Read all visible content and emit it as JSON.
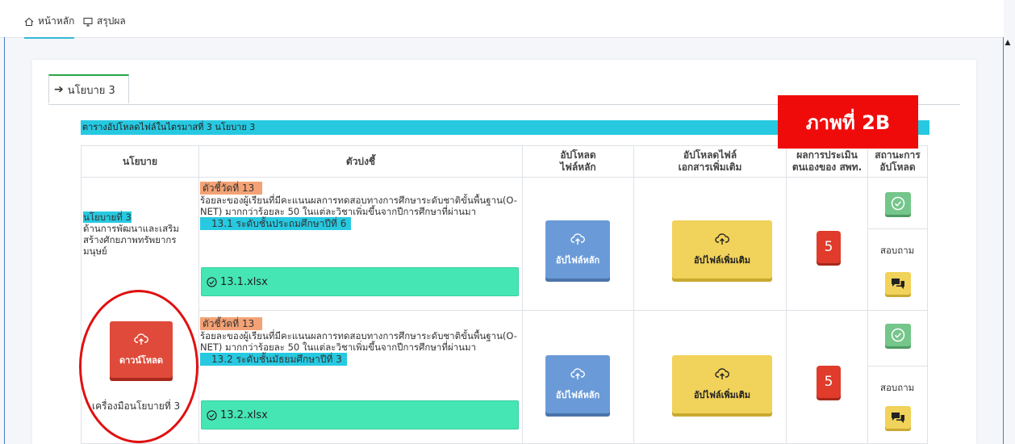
{
  "topnav": {
    "home_label": "หน้าหลัก",
    "summary_label": "สรุปผล"
  },
  "policy_tab": {
    "label": "นโยบาย 3"
  },
  "table": {
    "caption": "ตารางอัปโหลดไฟล์ในไตรมาสที่ 3 นโยบาย 3",
    "headers": {
      "policy": "นโยบาย",
      "indicator": "ตัวบ่งชี้",
      "main_upload_1": "อัปโหลด",
      "main_upload_2": "ไฟล์หลัก",
      "extra_upload_1": "อัปโหลดไฟล์",
      "extra_upload_2": "เอกสารเพิ่มเติม",
      "self_eval_1": "ผลการประเมิน",
      "self_eval_2": "ตนเองของ สพท.",
      "status_1": "สถานะการ",
      "status_2": "อัปโหลด"
    },
    "policy_cell": {
      "title": "นโยบายที่ 3",
      "description": "ด้านการพัฒนาและเสริมสร้างศักยภาพทรัพยากรมนุษย์",
      "download_label": "ดาวน์โหลด",
      "tools_label": "เครื่องมือนโยบายที่ 3"
    },
    "rows": [
      {
        "kpi": "ตัวชี้วัดที่ 13",
        "text": "ร้อยละของผู้เรียนที่มีคะแนนผลการทดสอบทางการศึกษาระดับชาติขั้นพื้นฐาน(O-NET) มากกว่าร้อยละ 50 ในแต่ละวิชาเพิ่มขึ้นจากปีการศึกษาที่ผ่านมา",
        "level": "13.1 ระดับชั้นประถมศึกษาปีที่ 6",
        "file": "13.1.xlsx",
        "main_btn": "อัปไฟล์หลัก",
        "extra_btn": "อัปไฟล์เพิ่มเติม",
        "score": "5",
        "ask": "สอบถาม"
      },
      {
        "kpi": "ตัวชี้วัดที่ 13",
        "text": "ร้อยละของผู้เรียนที่มีคะแนนผลการทดสอบทางการศึกษาระดับชาติขั้นพื้นฐาน(O-NET) มากกว่าร้อยละ 50 ในแต่ละวิชาเพิ่มขึ้นจากปีการศึกษาที่ผ่านมา",
        "level": "13.2 ระดับชั้นมัธยมศึกษาปีที่ 3",
        "file": "13.2.xlsx",
        "main_btn": "อัปไฟล์หลัก",
        "extra_btn": "อัปไฟล์เพิ่มเติม",
        "score": "5",
        "ask": "สอบถาม"
      }
    ]
  },
  "picture_label": "ภาพที่ 2B",
  "colors": {
    "caption_bar": "#27c9e1",
    "kpi_tag": "#f4a275",
    "file_box": "#45e6b4",
    "main_button": "#6a9bd8",
    "extra_button": "#f1d25a",
    "score_badge": "#e03b2b",
    "status_ok": "#74c68a",
    "download_button": "#e04a3a",
    "picture_label_bg": "#f00b0b"
  }
}
